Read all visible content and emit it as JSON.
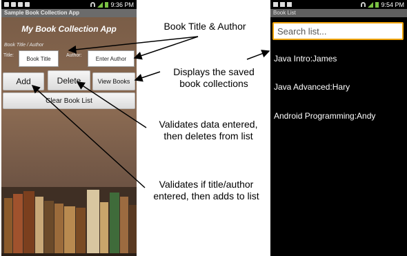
{
  "left_phone": {
    "status_time": "9:36 PM",
    "app_bar_title": "Sample Book Collection App",
    "heading": "My Book Collection App",
    "section_label": "Book Title / Author",
    "title_label": "Title:",
    "title_value": "Book Title",
    "author_label": "Author:",
    "author_value": "Enter Author",
    "add_button": "Add",
    "delete_button": "Delete",
    "view_button": "View Books",
    "clear_button": "Clear Book List"
  },
  "right_phone": {
    "status_time": "9:54 PM",
    "app_bar_title": "Book List",
    "search_placeholder": "Search list...",
    "items": [
      "Java Intro:James",
      "Java Advanced:Hary",
      "Android Programming:Andy"
    ]
  },
  "annotations": {
    "title_author": "Book Title & Author",
    "displays_line1": "Displays the saved",
    "displays_line2": "book collections",
    "delete_line1": "Validates data entered,",
    "delete_line2": "then deletes from list",
    "add_line1": "Validates if title/author",
    "add_line2": "entered, then adds to list"
  },
  "colors": {
    "search_border": "#f0a300",
    "signal": "#7ac143",
    "app_background": "#7a5c45"
  }
}
